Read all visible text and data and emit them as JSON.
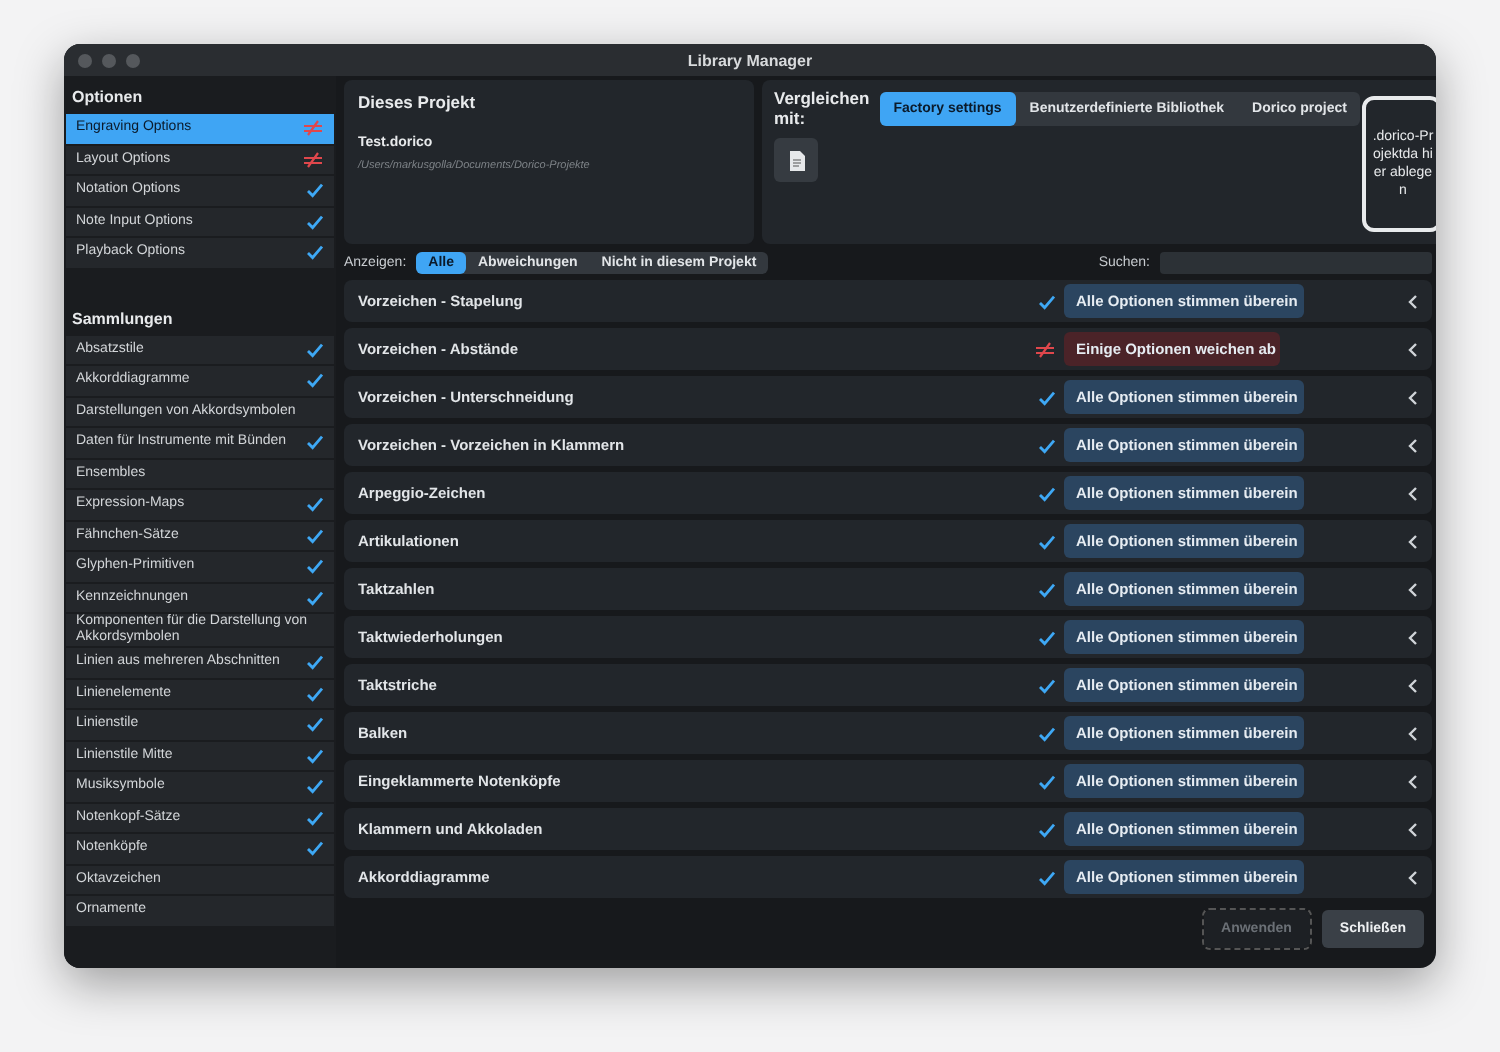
{
  "window": {
    "title": "Library Manager"
  },
  "sidebar": {
    "sections": [
      {
        "title": "Optionen",
        "items": [
          {
            "label": "Engraving Options",
            "selected": true,
            "matching": false,
            "differing": true
          },
          {
            "label": "Layout Options",
            "selected": false,
            "matching": false,
            "differing": true
          },
          {
            "label": "Notation Options",
            "selected": false,
            "matching": true,
            "differing": false
          },
          {
            "label": "Note Input Options",
            "selected": false,
            "matching": true,
            "differing": false
          },
          {
            "label": "Playback Options",
            "selected": false,
            "matching": true,
            "differing": false
          }
        ]
      },
      {
        "title": "Sammlungen",
        "items": [
          {
            "label": "Absatzstile",
            "selected": false,
            "matching": true,
            "differing": false
          },
          {
            "label": "Akkorddiagramme",
            "selected": false,
            "matching": true,
            "differing": false
          },
          {
            "label": "Darstellungen von Akkordsymbolen",
            "selected": false,
            "matching": false,
            "differing": false
          },
          {
            "label": "Daten für Instrumente mit Bünden",
            "selected": false,
            "matching": true,
            "differing": false
          },
          {
            "label": "Ensembles",
            "selected": false,
            "matching": false,
            "differing": false
          },
          {
            "label": "Expression-Maps",
            "selected": false,
            "matching": true,
            "differing": false
          },
          {
            "label": "Fähnchen-Sätze",
            "selected": false,
            "matching": true,
            "differing": false
          },
          {
            "label": "Glyphen-Primitiven",
            "selected": false,
            "matching": true,
            "differing": false
          },
          {
            "label": "Kennzeichnungen",
            "selected": false,
            "matching": true,
            "differing": false
          },
          {
            "label": "Komponenten für die Darstellung von Akkordsymbolen",
            "selected": false,
            "matching": false,
            "differing": false
          },
          {
            "label": "Linien aus mehreren Abschnitten",
            "selected": false,
            "matching": true,
            "differing": false
          },
          {
            "label": "Linienelemente",
            "selected": false,
            "matching": true,
            "differing": false
          },
          {
            "label": "Linienstile",
            "selected": false,
            "matching": true,
            "differing": false
          },
          {
            "label": "Linienstile Mitte",
            "selected": false,
            "matching": true,
            "differing": false
          },
          {
            "label": "Musiksymbole",
            "selected": false,
            "matching": true,
            "differing": false
          },
          {
            "label": "Notenkopf-Sätze",
            "selected": false,
            "matching": true,
            "differing": false
          },
          {
            "label": "Notenköpfe",
            "selected": false,
            "matching": true,
            "differing": false
          },
          {
            "label": "Oktavzeichen",
            "selected": false,
            "matching": false,
            "differing": false
          },
          {
            "label": "Ornamente",
            "selected": false,
            "matching": false,
            "differing": false
          }
        ]
      }
    ]
  },
  "project": {
    "title": "Dieses Projekt",
    "file": "Test.dorico",
    "path": "/Users/markusgolla/Documents/Dorico-Projekte"
  },
  "compare": {
    "label": "Vergleichen mit:",
    "options": [
      {
        "label": "Factory settings",
        "selected": true
      },
      {
        "label": "Benutzerdefinierte Bibliothek",
        "selected": false
      },
      {
        "label": "Dorico project",
        "selected": false
      }
    ],
    "drop_hint": ".dorico-Projektda hier ablegen"
  },
  "filter": {
    "label": "Anzeigen:",
    "options": [
      {
        "label": "Alle",
        "selected": true
      },
      {
        "label": "Abweichungen",
        "selected": false
      },
      {
        "label": "Nicht in diesem Projekt",
        "selected": false
      }
    ],
    "search_label": "Suchen:"
  },
  "rows": [
    {
      "name": "Vorzeichen - Stapelung",
      "differing": false,
      "badge": "Alle Optionen stimmen überein"
    },
    {
      "name": "Vorzeichen - Abstände",
      "differing": true,
      "badge": "Einige Optionen weichen ab"
    },
    {
      "name": "Vorzeichen - Unterschneidung",
      "differing": false,
      "badge": "Alle Optionen stimmen überein"
    },
    {
      "name": "Vorzeichen - Vorzeichen in Klammern",
      "differing": false,
      "badge": "Alle Optionen stimmen überein"
    },
    {
      "name": "Arpeggio-Zeichen",
      "differing": false,
      "badge": "Alle Optionen stimmen überein"
    },
    {
      "name": "Artikulationen",
      "differing": false,
      "badge": "Alle Optionen stimmen überein"
    },
    {
      "name": "Taktzahlen",
      "differing": false,
      "badge": "Alle Optionen stimmen überein"
    },
    {
      "name": "Taktwiederholungen",
      "differing": false,
      "badge": "Alle Optionen stimmen überein"
    },
    {
      "name": "Taktstriche",
      "differing": false,
      "badge": "Alle Optionen stimmen überein"
    },
    {
      "name": "Balken",
      "differing": false,
      "badge": "Alle Optionen stimmen überein"
    },
    {
      "name": "Eingeklammerte Notenköpfe",
      "differing": false,
      "badge": "Alle Optionen stimmen überein"
    },
    {
      "name": "Klammern und Akkoladen",
      "differing": false,
      "badge": "Alle Optionen stimmen überein"
    },
    {
      "name": "Akkorddiagramme",
      "differing": false,
      "badge": "Alle Optionen stimmen überein"
    }
  ],
  "buttons": [
    {
      "label": "Anwenden",
      "disabled": true
    },
    {
      "label": "Schließen",
      "disabled": false
    }
  ]
}
